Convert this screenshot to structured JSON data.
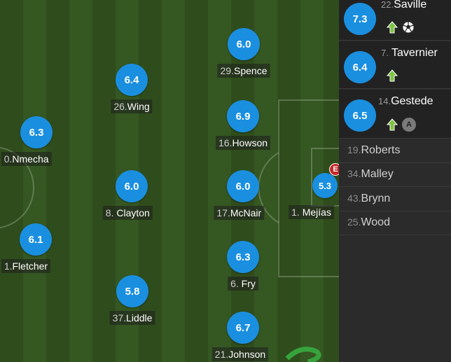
{
  "players": [
    {
      "id": "saville",
      "num": "22.",
      "name": "Saville",
      "rating": "7.3"
    },
    {
      "id": "spence",
      "num": "29.",
      "name": "Spence",
      "rating": "6.0"
    },
    {
      "id": "wing",
      "num": "26.",
      "name": "Wing",
      "rating": "6.4"
    },
    {
      "id": "nmecha",
      "num": "0.",
      "name": "Nmecha",
      "rating": "6.3"
    },
    {
      "id": "howson",
      "num": "16.",
      "name": "Howson",
      "rating": "6.9"
    },
    {
      "id": "clayton",
      "num": "8.",
      "name": "Clayton",
      "rating": "6.0"
    },
    {
      "id": "mcnair",
      "num": "17.",
      "name": "McNair",
      "rating": "6.0"
    },
    {
      "id": "mejias",
      "num": "1.",
      "name": "Mejías",
      "rating": "5.3"
    },
    {
      "id": "fletcher",
      "num": "1.",
      "name": "Fletcher",
      "rating": "6.1"
    },
    {
      "id": "fry",
      "num": "6.",
      "name": "Fry",
      "rating": "6.3"
    },
    {
      "id": "liddle",
      "num": "37.",
      "name": "Liddle",
      "rating": "5.8"
    },
    {
      "id": "johnson",
      "num": "21.",
      "name": "Johnson",
      "rating": "6.7"
    }
  ],
  "subs": [
    {
      "num": "22.",
      "name": "Saville",
      "rating": "7.3",
      "icons": [
        "sub-in-arrow-icon",
        "goal-ball-icon"
      ]
    },
    {
      "num": "7.",
      "name": "Tavernier",
      "rating": "6.4",
      "icons": [
        "sub-in-arrow-icon"
      ]
    },
    {
      "num": "14.",
      "name": "Gestede",
      "rating": "6.5",
      "icons": [
        "sub-in-arrow-icon",
        "assist-icon"
      ]
    }
  ],
  "assist_letter": "A",
  "error_badge": "E",
  "bench": [
    {
      "num": "19.",
      "name": "Roberts"
    },
    {
      "num": "34.",
      "name": "Malley"
    },
    {
      "num": "43.",
      "name": "Brynn"
    },
    {
      "num": "25.",
      "name": "Wood"
    }
  ],
  "colors": {
    "rating_blue": "#1a8fe0",
    "sub_in_green": "#7dc242",
    "sub_off_red": "#d32f2f"
  }
}
